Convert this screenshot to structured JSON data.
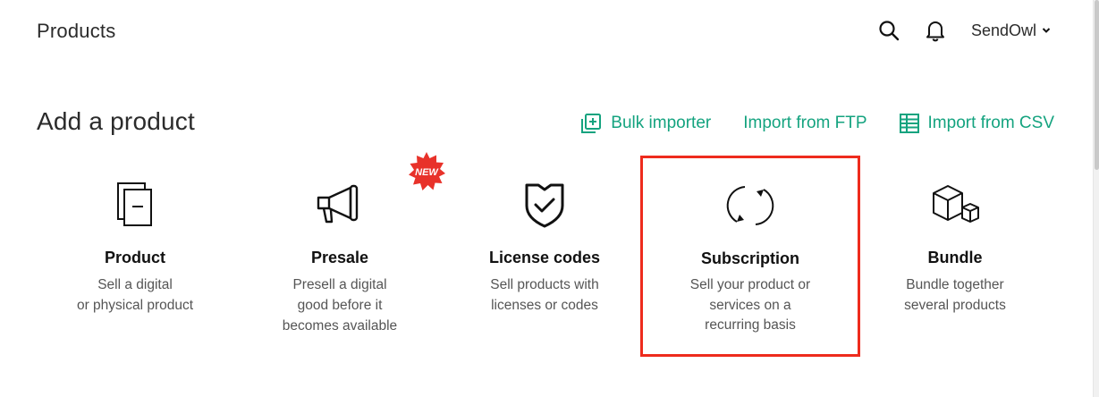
{
  "header": {
    "title": "Products",
    "account_name": "SendOwl"
  },
  "add_product": {
    "title": "Add a product",
    "import_links": {
      "bulk": "Bulk importer",
      "ftp": "Import from FTP",
      "csv": "Import from CSV"
    },
    "new_badge": "NEW",
    "cards": {
      "product": {
        "title": "Product",
        "desc_1": "Sell a digital",
        "desc_2": "or physical product"
      },
      "presale": {
        "title": "Presale",
        "desc_1": "Presell a digital",
        "desc_2": "good before it",
        "desc_3": "becomes available"
      },
      "license": {
        "title": "License codes",
        "desc_1": "Sell products with",
        "desc_2": "licenses or codes"
      },
      "subscription": {
        "title": "Subscription",
        "desc_1": "Sell your product or",
        "desc_2": "services on a",
        "desc_3": "recurring basis"
      },
      "bundle": {
        "title": "Bundle",
        "desc_1": "Bundle together",
        "desc_2": "several products"
      }
    }
  },
  "colors": {
    "accent": "#14a37f",
    "highlight_border": "#ee2b1d",
    "badge": "#e8322a"
  }
}
